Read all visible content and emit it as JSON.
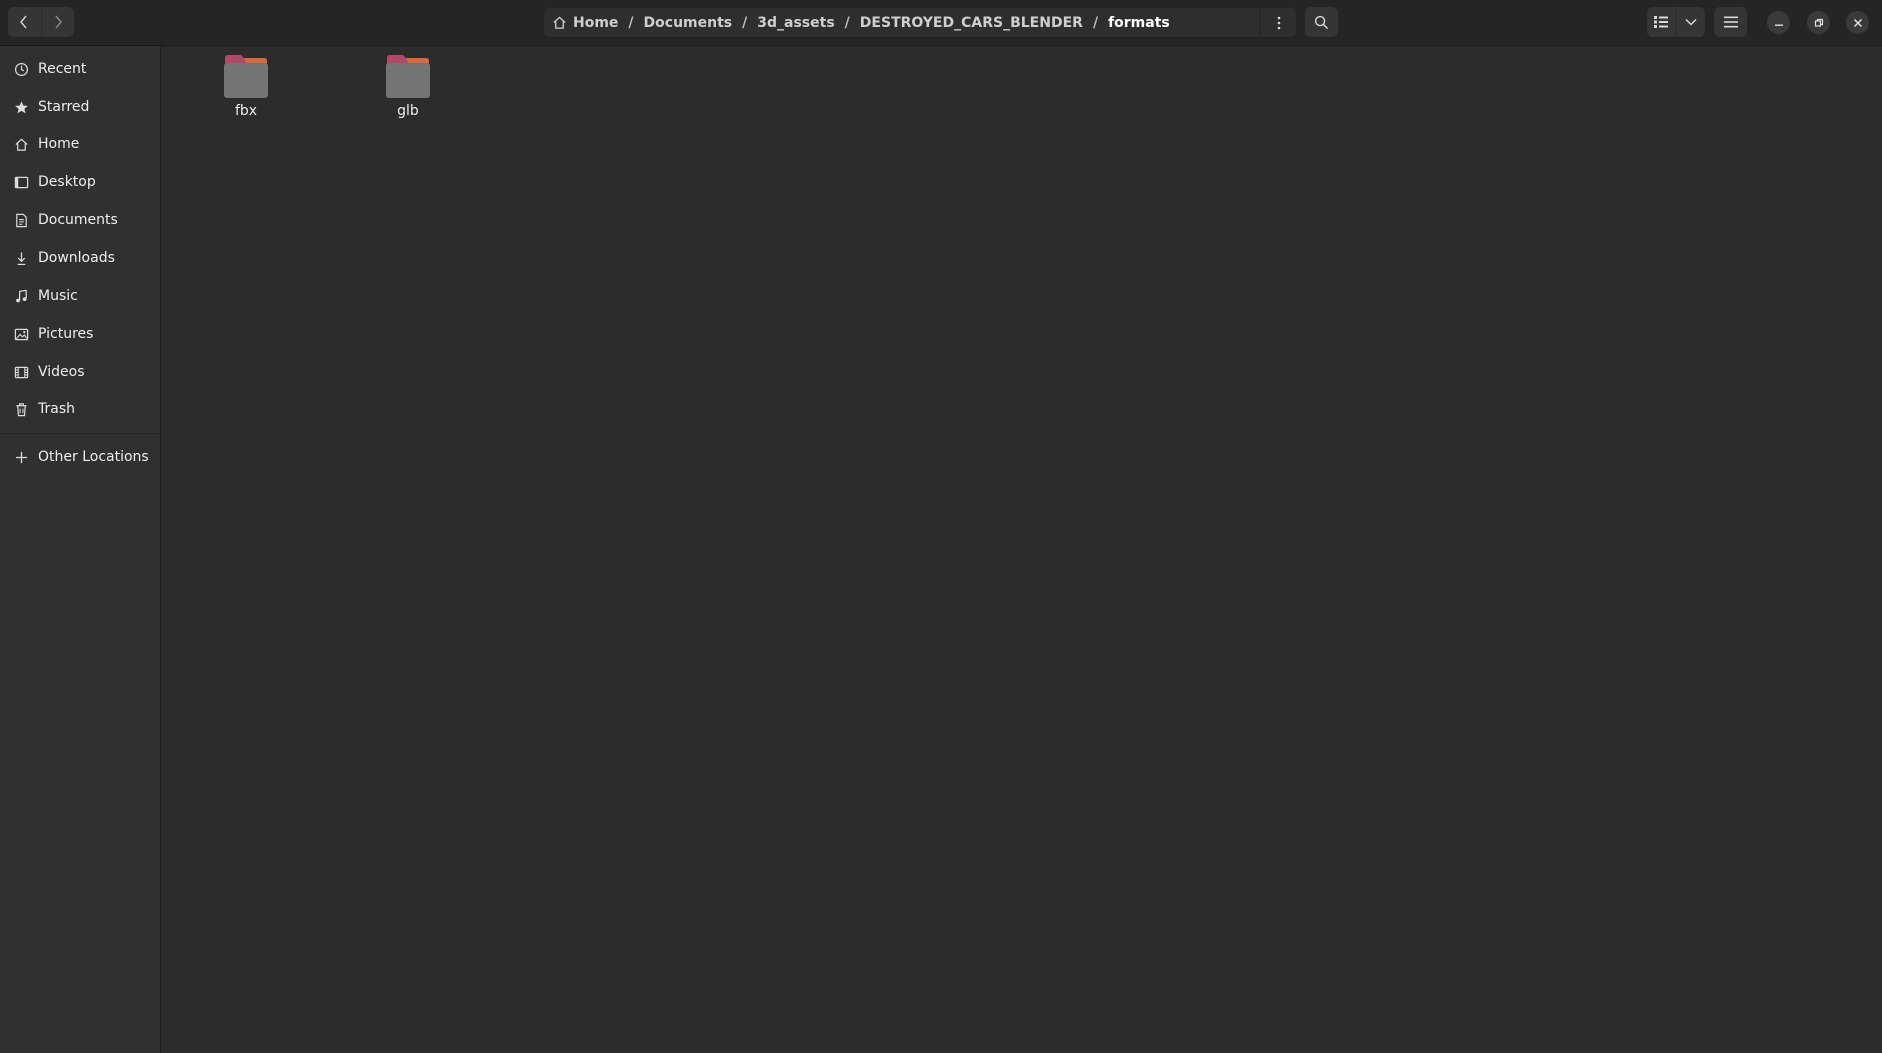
{
  "header": {
    "breadcrumbs": [
      {
        "label": "Home",
        "icon": "home-icon"
      },
      {
        "label": "Documents"
      },
      {
        "label": "3d_assets"
      },
      {
        "label": "DESTROYED_CARS_BLENDER"
      },
      {
        "label": "formats",
        "current": true
      }
    ],
    "separator": "/"
  },
  "sidebar": {
    "items": [
      {
        "label": "Recent",
        "icon": "clock-icon"
      },
      {
        "label": "Starred",
        "icon": "star-icon"
      },
      {
        "label": "Home",
        "icon": "home-icon"
      },
      {
        "label": "Desktop",
        "icon": "desktop-icon"
      },
      {
        "label": "Documents",
        "icon": "document-icon"
      },
      {
        "label": "Downloads",
        "icon": "download-icon"
      },
      {
        "label": "Music",
        "icon": "music-icon"
      },
      {
        "label": "Pictures",
        "icon": "picture-icon"
      },
      {
        "label": "Videos",
        "icon": "video-icon"
      },
      {
        "label": "Trash",
        "icon": "trash-icon"
      }
    ],
    "other_locations": {
      "label": "Other Locations",
      "icon": "plus-icon"
    }
  },
  "files": [
    {
      "name": "fbx",
      "icon": "folder-icon"
    },
    {
      "name": "glb",
      "icon": "folder-icon"
    }
  ],
  "colors": {
    "folder_body": "#747474",
    "folder_tab": "#b04a66",
    "folder_accent": "#e0703a"
  }
}
